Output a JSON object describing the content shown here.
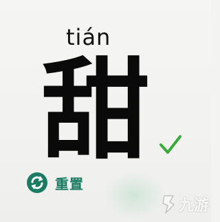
{
  "card": {
    "pinyin": "tián",
    "character": "甜"
  },
  "status": {
    "correct_icon": "check-mark-icon",
    "color": "#3aaa3a"
  },
  "controls": {
    "reset_label": "重置",
    "reset_icon": "refresh-arrows-icon",
    "accent_color": "#1c7c63"
  },
  "watermark": {
    "text": "九游",
    "icon": "jiuyou-logo-icon"
  }
}
